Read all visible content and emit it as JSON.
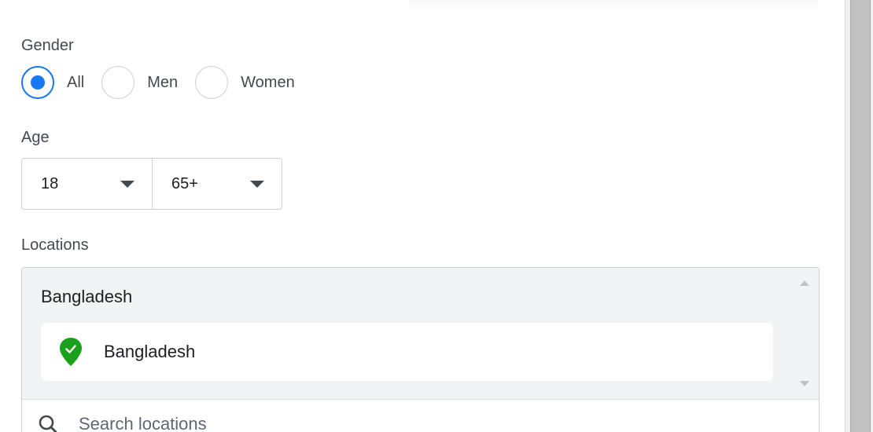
{
  "gender": {
    "label": "Gender",
    "options": [
      {
        "label": "All",
        "checked": true
      },
      {
        "label": "Men",
        "checked": false
      },
      {
        "label": "Women",
        "checked": false
      }
    ]
  },
  "age": {
    "label": "Age",
    "min": "18",
    "max": "65+"
  },
  "locations": {
    "label": "Locations",
    "group_title": "Bangladesh",
    "items": [
      {
        "name": "Bangladesh",
        "icon": "location-pin-check-icon"
      }
    ],
    "search_placeholder": "Search locations"
  },
  "colors": {
    "accent": "#1877f2",
    "pin": "#1ba01b"
  }
}
